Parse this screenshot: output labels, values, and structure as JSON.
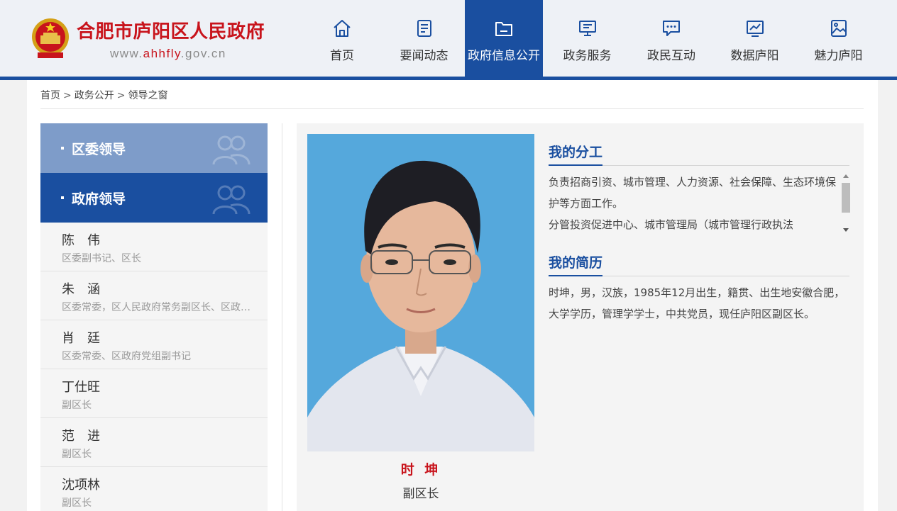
{
  "header": {
    "site_title": "合肥市庐阳区人民政府",
    "site_url_prefix": "www.",
    "site_url_domain": "ahhfly",
    "site_url_suffix": ".gov.cn",
    "accent_color": "#1a4fa0",
    "brand_red": "#c8141c"
  },
  "nav": [
    {
      "label": "首页",
      "icon": "home-icon"
    },
    {
      "label": "要闻动态",
      "icon": "document-icon"
    },
    {
      "label": "政府信息公开",
      "icon": "folder-icon",
      "active": true
    },
    {
      "label": "政务服务",
      "icon": "monitor-icon"
    },
    {
      "label": "政民互动",
      "icon": "chat-icon"
    },
    {
      "label": "数据庐阳",
      "icon": "chart-icon"
    },
    {
      "label": "魅力庐阳",
      "icon": "image-icon"
    }
  ],
  "breadcrumb": {
    "home": "首页",
    "level1": "政务公开",
    "level2": "领导之窗",
    "separator": ">"
  },
  "sidebar": {
    "section1": "区委领导",
    "section2": "政府领导",
    "leaders": [
      {
        "name": "陈　伟",
        "title": "区委副书记、区长"
      },
      {
        "name": "朱　涵",
        "title": "区委常委，区人民政府常务副区长、区政府党组副书记"
      },
      {
        "name": "肖　廷",
        "title": "区委常委、区政府党组副书记"
      },
      {
        "name": "丁仕旺",
        "title": "副区长"
      },
      {
        "name": "范　进",
        "title": "副区长"
      },
      {
        "name": "沈项林",
        "title": "副区长"
      }
    ]
  },
  "profile": {
    "name": "时 坤",
    "position": "副区长",
    "duty_heading": "我的分工",
    "duty_p1": "负责招商引资、城市管理、人力资源、社会保障、生态环境保护等方面工作。",
    "duty_p2": "分管投资促进中心、城市管理局（城市管理行政执法",
    "resume_heading": "我的简历",
    "resume_text": "时坤，男，汉族，1985年12月出生，籍贯、出生地安徽合肥，大学学历，管理学学士，中共党员，现任庐阳区副区长。"
  }
}
